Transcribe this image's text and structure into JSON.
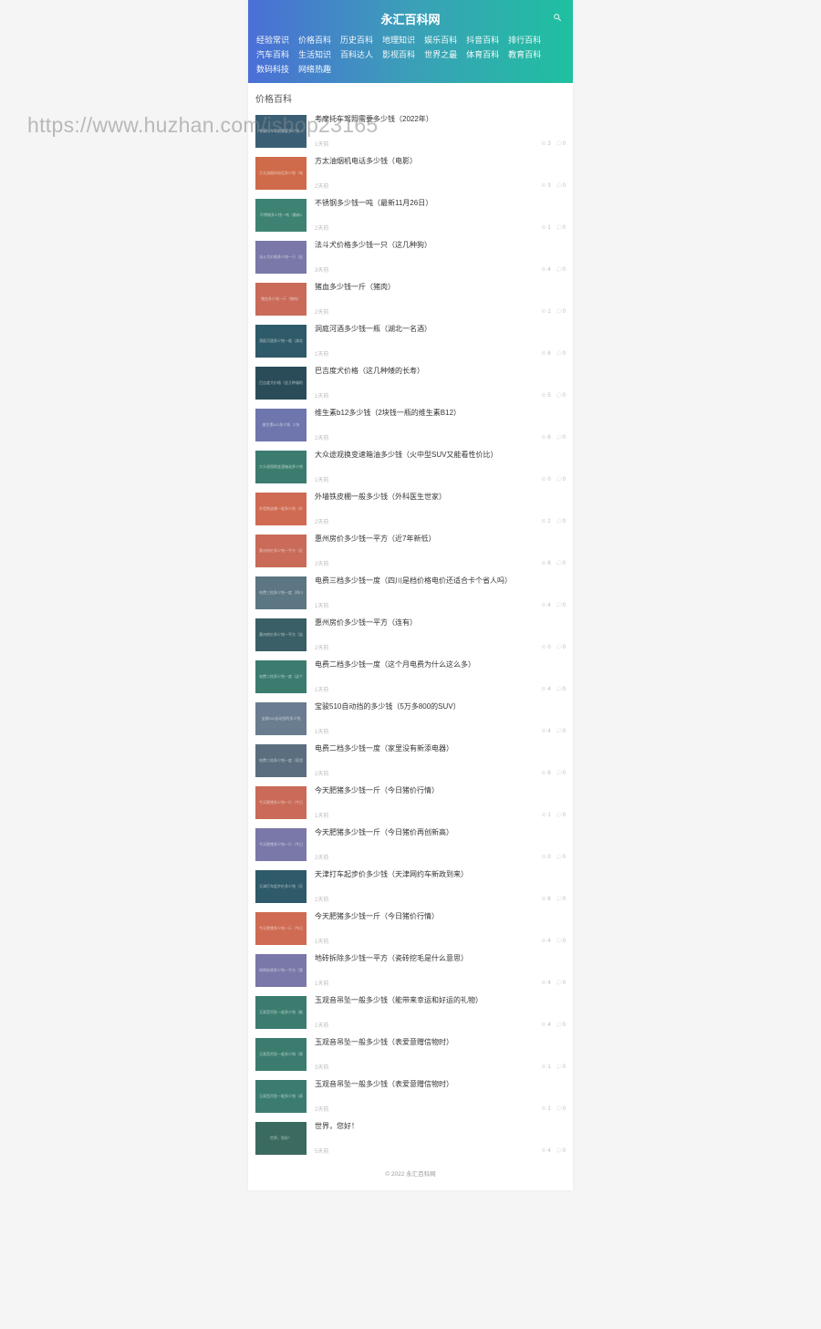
{
  "watermark": "https://www.huzhan.com/ishop23165",
  "header": {
    "brand": "永汇百科网",
    "search_icon": "search-icon",
    "nav": [
      "经验常识",
      "价格百科",
      "历史百科",
      "地理知识",
      "娱乐百科",
      "抖音百科",
      "排行百科",
      "汽车百科",
      "生活知识",
      "百科达人",
      "影视百科",
      "世界之最",
      "体育百科",
      "教育百科",
      "数码科技",
      "网络热趣"
    ]
  },
  "category": {
    "title": "价格百科"
  },
  "items": [
    {
      "title": "考摩托车驾照需要多少钱（2022年）",
      "time": "1天前",
      "views": 3,
      "comments": 0,
      "thumb": "c0"
    },
    {
      "title": "方太油烟机电话多少钱（电影）",
      "time": "2天前",
      "views": 3,
      "comments": 0,
      "thumb": "c1"
    },
    {
      "title": "不锈钢多少钱一吨（最新11月26日）",
      "time": "2天前",
      "views": 1,
      "comments": 0,
      "thumb": "c2"
    },
    {
      "title": "法斗犬价格多少钱一只（这几种狗）",
      "time": "3天前",
      "views": 4,
      "comments": 0,
      "thumb": "c3"
    },
    {
      "title": "猪血多少钱一斤（猪肉）",
      "time": "2天前",
      "views": 1,
      "comments": 0,
      "thumb": "c4"
    },
    {
      "title": "洞庭河酒多少钱一瓶（湖北一名酒）",
      "time": "1天前",
      "views": 6,
      "comments": 0,
      "thumb": "c5"
    },
    {
      "title": "巴吉度犬价格（这几种矮的长寿）",
      "time": "1天前",
      "views": 5,
      "comments": 0,
      "thumb": "c6"
    },
    {
      "title": "维生素b12多少钱（2块钱一瓶的维生素B12）",
      "time": "2天前",
      "views": 6,
      "comments": 0,
      "thumb": "c7"
    },
    {
      "title": "大众途观换变速箱油多少钱（火中型SUV又能看性价比）",
      "time": "1天前",
      "views": 0,
      "comments": 0,
      "thumb": "c8"
    },
    {
      "title": "外墙铁皮棚一般多少钱（外科医生世家）",
      "time": "2天前",
      "views": 2,
      "comments": 0,
      "thumb": "c9"
    },
    {
      "title": "惠州房价多少钱一平方（近7年新低）",
      "time": "2天前",
      "views": 6,
      "comments": 0,
      "thumb": "c10"
    },
    {
      "title": "电费三档多少钱一度（四川是档价格电价还适合卡个省人吗）",
      "time": "1天前",
      "views": 4,
      "comments": 0,
      "thumb": "c11"
    },
    {
      "title": "惠州房价多少钱一平方（连有）",
      "time": "2天前",
      "views": 0,
      "comments": 0,
      "thumb": "c12"
    },
    {
      "title": "电费二档多少钱一度（这个月电费为什么这么多）",
      "time": "1天前",
      "views": 4,
      "comments": 0,
      "thumb": "c13"
    },
    {
      "title": "宝骏510自动挡的多少钱（5万多800的SUV）",
      "time": "1天前",
      "views": 4,
      "comments": 0,
      "thumb": "c14"
    },
    {
      "title": "电费二档多少钱一度（家里没有新添电器）",
      "time": "2天前",
      "views": 6,
      "comments": 0,
      "thumb": "c15"
    },
    {
      "title": "今天肥猪多少钱一斤（今日猪价行情）",
      "time": "1天前",
      "views": 1,
      "comments": 0,
      "thumb": "c16"
    },
    {
      "title": "今天肥猪多少钱一斤（今日猪价再创新高）",
      "time": "2天前",
      "views": 0,
      "comments": 0,
      "thumb": "c17"
    },
    {
      "title": "天津打车起步价多少钱（天津网约车新政到来）",
      "time": "2天前",
      "views": 6,
      "comments": 0,
      "thumb": "c18"
    },
    {
      "title": "今天肥猪多少钱一斤（今日猪价行情）",
      "time": "1天前",
      "views": 4,
      "comments": 0,
      "thumb": "c19"
    },
    {
      "title": "地砖拆除多少钱一平方（瓷砖挖毛是什么意思）",
      "time": "1天前",
      "views": 4,
      "comments": 0,
      "thumb": "c20"
    },
    {
      "title": "玉观音吊坠一般多少钱（能带来幸运和好运的礼物）",
      "time": "1天前",
      "views": 4,
      "comments": 0,
      "thumb": "c21"
    },
    {
      "title": "玉观音吊坠一般多少钱（表爱意赠信物时）",
      "time": "3天前",
      "views": 1,
      "comments": 0,
      "thumb": "c22"
    },
    {
      "title": "玉观音吊坠一般多少钱（表爱意赠信物时）",
      "time": "2天前",
      "views": 1,
      "comments": 0,
      "thumb": "c22"
    },
    {
      "title": "世界，您好！",
      "time": "5天前",
      "views": 4,
      "comments": 0,
      "thumb": "c23"
    }
  ],
  "footer": {
    "copyright": "© 2022 永汇百科网"
  }
}
